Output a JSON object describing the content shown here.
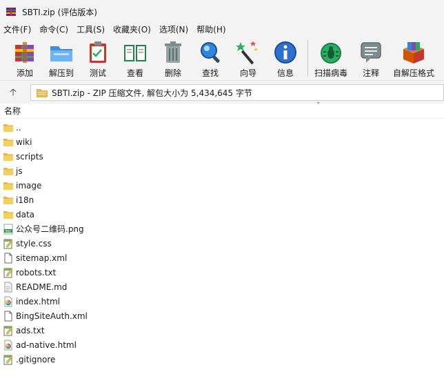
{
  "window": {
    "title": "SBTI.zip (评估版本)"
  },
  "menu": [
    "文件(F)",
    "命令(C)",
    "工具(S)",
    "收藏夹(O)",
    "选项(N)",
    "帮助(H)"
  ],
  "toolbar": {
    "add": "添加",
    "extract": "解压到",
    "test": "测试",
    "view": "查看",
    "delete": "删除",
    "find": "查找",
    "wizard": "向导",
    "info": "信息",
    "virus": "扫描病毒",
    "comment": "注释",
    "sfx": "自解压格式"
  },
  "address": {
    "path": "SBTI.zip - ZIP 压缩文件, 解包大小为 5,434,645 字节"
  },
  "columns": {
    "name": "名称"
  },
  "files": [
    {
      "name": "..",
      "kind": "folder"
    },
    {
      "name": "wiki",
      "kind": "folder"
    },
    {
      "name": "scripts",
      "kind": "folder"
    },
    {
      "name": "js",
      "kind": "folder"
    },
    {
      "name": "image",
      "kind": "folder"
    },
    {
      "name": "i18n",
      "kind": "folder"
    },
    {
      "name": "data",
      "kind": "folder"
    },
    {
      "name": "公众号二维码.png",
      "kind": "png"
    },
    {
      "name": "style.css",
      "kind": "notepad"
    },
    {
      "name": "sitemap.xml",
      "kind": "blank"
    },
    {
      "name": "robots.txt",
      "kind": "notepad"
    },
    {
      "name": "README.md",
      "kind": "md"
    },
    {
      "name": "index.html",
      "kind": "chrome"
    },
    {
      "name": "BingSiteAuth.xml",
      "kind": "blank"
    },
    {
      "name": "ads.txt",
      "kind": "notepad"
    },
    {
      "name": "ad-native.html",
      "kind": "chrome"
    },
    {
      "name": ".gitignore",
      "kind": "notepad"
    }
  ]
}
